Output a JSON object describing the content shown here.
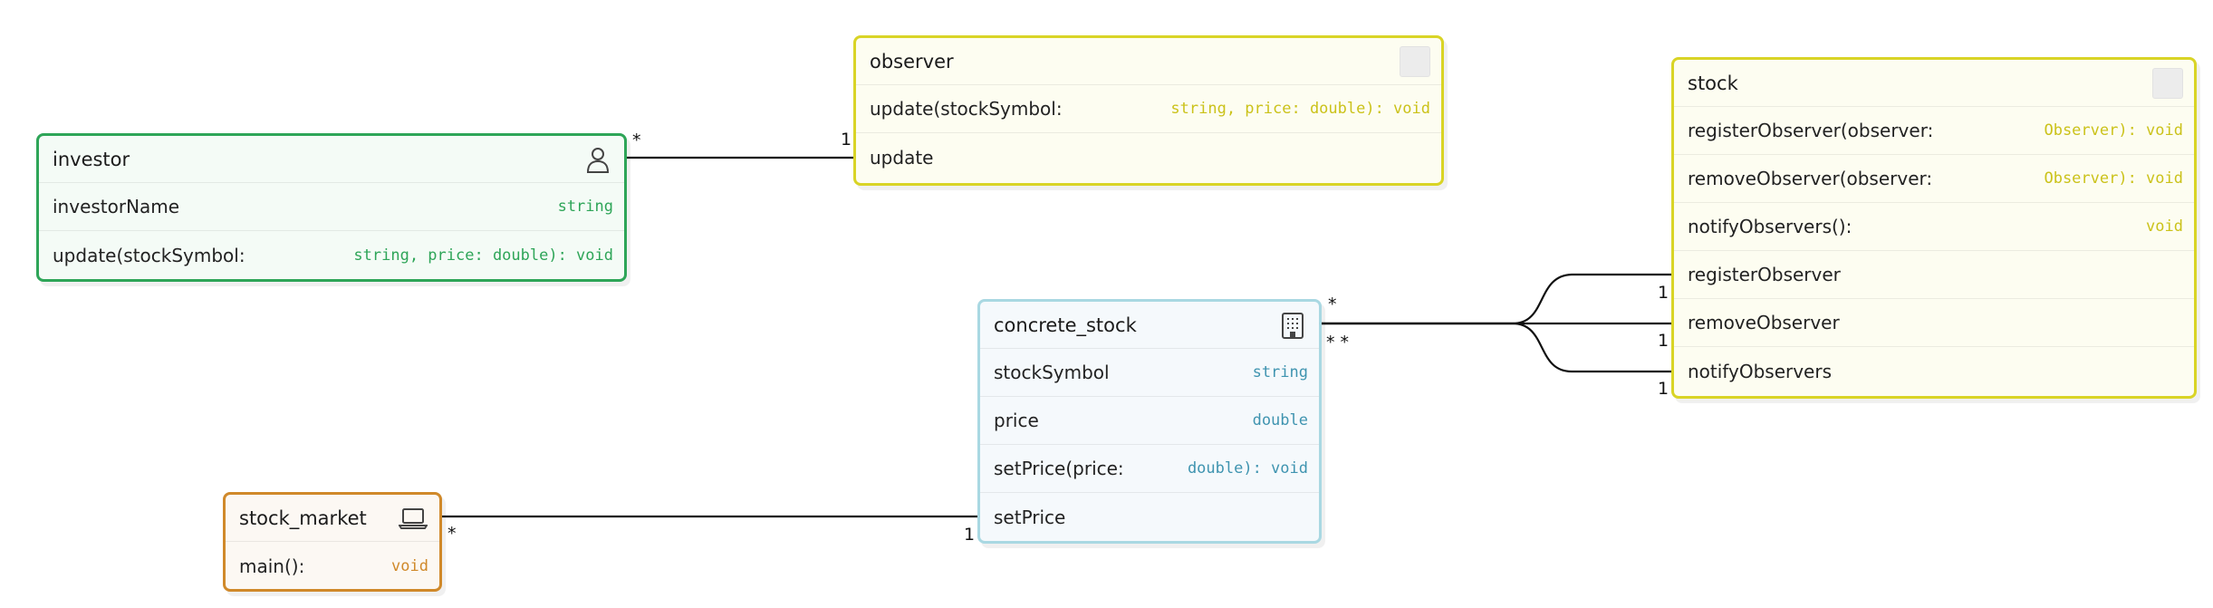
{
  "colors": {
    "investor": {
      "border": "#2ea558",
      "bg": "#f4fbf6",
      "type": "#2ea558"
    },
    "observer": {
      "border": "#d9d426",
      "bg": "#fdfdf1",
      "type": "#cbc21a"
    },
    "stock": {
      "border": "#d9d426",
      "bg": "#fdfdf1",
      "type": "#cbc21a"
    },
    "concrete_stock": {
      "border": "#a9d8e2",
      "bg": "#f5f9fc",
      "type": "#3f94b0"
    },
    "stock_market": {
      "border": "#d0892a",
      "bg": "#fcf8f3",
      "type": "#d0892a"
    }
  },
  "entities": {
    "investor": {
      "title": "investor",
      "icon": "person-icon",
      "rows": [
        {
          "name": "investorName",
          "type": "string"
        },
        {
          "name": "update(stockSymbol:",
          "type": "string, price: double): void"
        }
      ]
    },
    "observer": {
      "title": "observer",
      "icon": "placeholder-icon",
      "rows": [
        {
          "name": "update(stockSymbol:",
          "type": "string, price: double): void"
        },
        {
          "name": "update",
          "type": ""
        }
      ]
    },
    "stock": {
      "title": "stock",
      "icon": "placeholder-icon",
      "rows": [
        {
          "name": "registerObserver(observer:",
          "type": "Observer): void"
        },
        {
          "name": "removeObserver(observer:",
          "type": "Observer): void"
        },
        {
          "name": "notifyObservers():",
          "type": "void"
        },
        {
          "name": "registerObserver",
          "type": ""
        },
        {
          "name": "removeObserver",
          "type": ""
        },
        {
          "name": "notifyObservers",
          "type": ""
        }
      ]
    },
    "concrete_stock": {
      "title": "concrete_stock",
      "icon": "building-icon",
      "rows": [
        {
          "name": "stockSymbol",
          "type": "string"
        },
        {
          "name": "price",
          "type": "double"
        },
        {
          "name": "setPrice(price:",
          "type": "double): void"
        },
        {
          "name": "setPrice",
          "type": ""
        }
      ]
    },
    "stock_market": {
      "title": "stock_market",
      "icon": "laptop-icon",
      "rows": [
        {
          "name": "main():",
          "type": "void"
        }
      ]
    }
  },
  "multiplicities": {
    "investor_observer_source": "*",
    "investor_observer_target": "1",
    "concrete_stock_stock_source_a": "*",
    "concrete_stock_stock_source_b": "* *",
    "concrete_stock_stock_target_1": "1",
    "concrete_stock_stock_target_2": "1",
    "concrete_stock_stock_target_3": "1",
    "stock_market_concrete_stock_source": "*",
    "stock_market_concrete_stock_target": "1"
  }
}
